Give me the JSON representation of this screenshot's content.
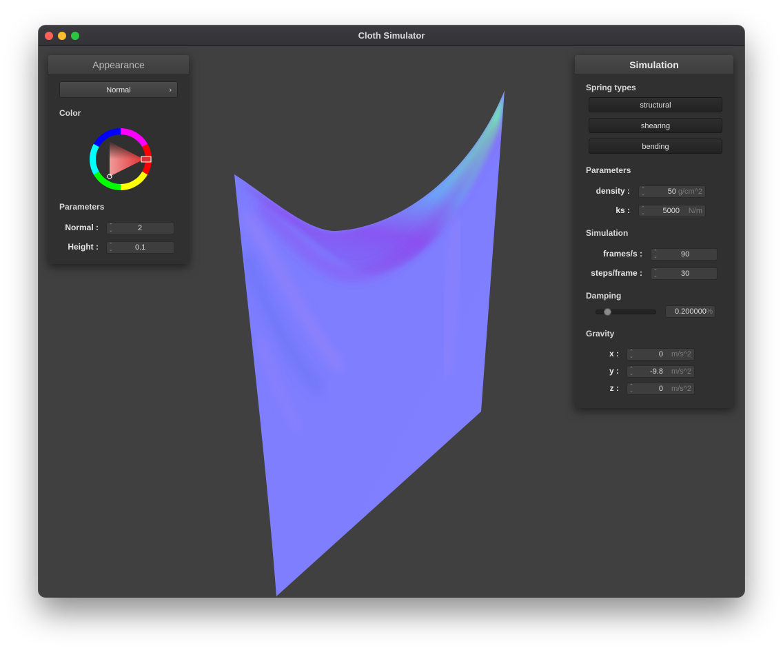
{
  "window": {
    "title": "Cloth Simulator"
  },
  "appearance": {
    "header": "Appearance",
    "shader": "Normal",
    "color_label": "Color",
    "color_selected": "#e03030",
    "params_label": "Parameters",
    "params": [
      {
        "label": "Normal :",
        "value": "2"
      },
      {
        "label": "Height :",
        "value": "0.1"
      }
    ]
  },
  "simulation": {
    "header": "Simulation",
    "spring_label": "Spring types",
    "springs": [
      "structural",
      "shearing",
      "bending"
    ],
    "params_label": "Parameters",
    "params": [
      {
        "label": "density :",
        "value": "50",
        "unit": "g/cm^2"
      },
      {
        "label": "ks :",
        "value": "5000",
        "unit": "N/m"
      }
    ],
    "sim_label": "Simulation",
    "sim": [
      {
        "label": "frames/s :",
        "value": "90"
      },
      {
        "label": "steps/frame :",
        "value": "30"
      }
    ],
    "damping_label": "Damping",
    "damping": {
      "value": "0.200000",
      "unit": "%"
    },
    "gravity_label": "Gravity",
    "gravity": [
      {
        "label": "x :",
        "value": "0",
        "unit": "m/s^2"
      },
      {
        "label": "y :",
        "value": "-9.8",
        "unit": "m/s^2"
      },
      {
        "label": "z :",
        "value": "0",
        "unit": "m/s^2"
      }
    ]
  },
  "colors": {
    "cloth_base": "#8080ff",
    "cloth_magenta": "#9a50f0",
    "cloth_green": "#70f0a0"
  }
}
